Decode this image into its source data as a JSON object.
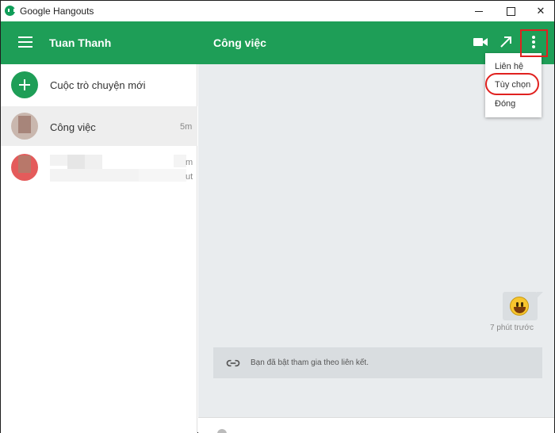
{
  "window": {
    "title": "Google Hangouts",
    "icon": "hangouts-icon",
    "controls": [
      "minimize-icon",
      "maximize-icon",
      "close-icon"
    ],
    "close_glyph": "✕"
  },
  "header": {
    "user_name": "Tuan Thanh",
    "conversation_title": "Công việc",
    "accent_color": "#1e9e57",
    "icons": [
      "menu-icon",
      "video-icon",
      "popout-icon",
      "more-vert-icon"
    ]
  },
  "sidebar": {
    "new_conversation_label": "Cuộc trò chuyện mới",
    "conversations": [
      {
        "name": "Công việc",
        "time": "5m",
        "active": true
      },
      {
        "name": "",
        "time": "m",
        "preview_tail": "ut",
        "blurred": true
      }
    ]
  },
  "menu": {
    "items": [
      "Liên hệ",
      "Tùy chọn",
      "Đóng"
    ],
    "highlighted_item": "Tùy chọn"
  },
  "chat": {
    "messages": [
      {
        "type": "emoji",
        "emoji": "smiley",
        "time": "7 phút trước"
      }
    ],
    "system_message": "Bạn đã bật tham gia theo liên kết."
  },
  "annotation_color": "#e0211f"
}
